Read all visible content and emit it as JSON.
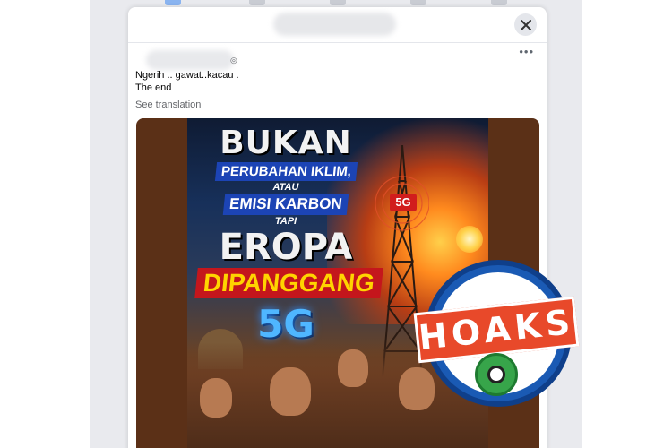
{
  "post": {
    "text_line1": "Ngerih .. gawat..kacau .",
    "text_line2": "The end",
    "see_translation": "See translation",
    "more_label": "•••",
    "globe_icon": "globe-icon"
  },
  "modal": {
    "close_icon": "close-icon"
  },
  "image": {
    "headline_1": "BUKAN",
    "headline_2": "PERUBAHAN IKLIM,",
    "headline_3": "ATAU",
    "headline_4": "EMISI KARBON",
    "headline_5": "TAPI",
    "headline_6": "EROPA",
    "headline_7": "DIPANGGANG",
    "headline_8": "5G",
    "tower_label": "5G"
  },
  "stamp": {
    "label": "HOAKS"
  },
  "colors": {
    "frame": "#5b3017",
    "stamp_blue": "#1a5ab4",
    "stamp_red": "#e8492a",
    "headline_red": "#c4161c"
  }
}
